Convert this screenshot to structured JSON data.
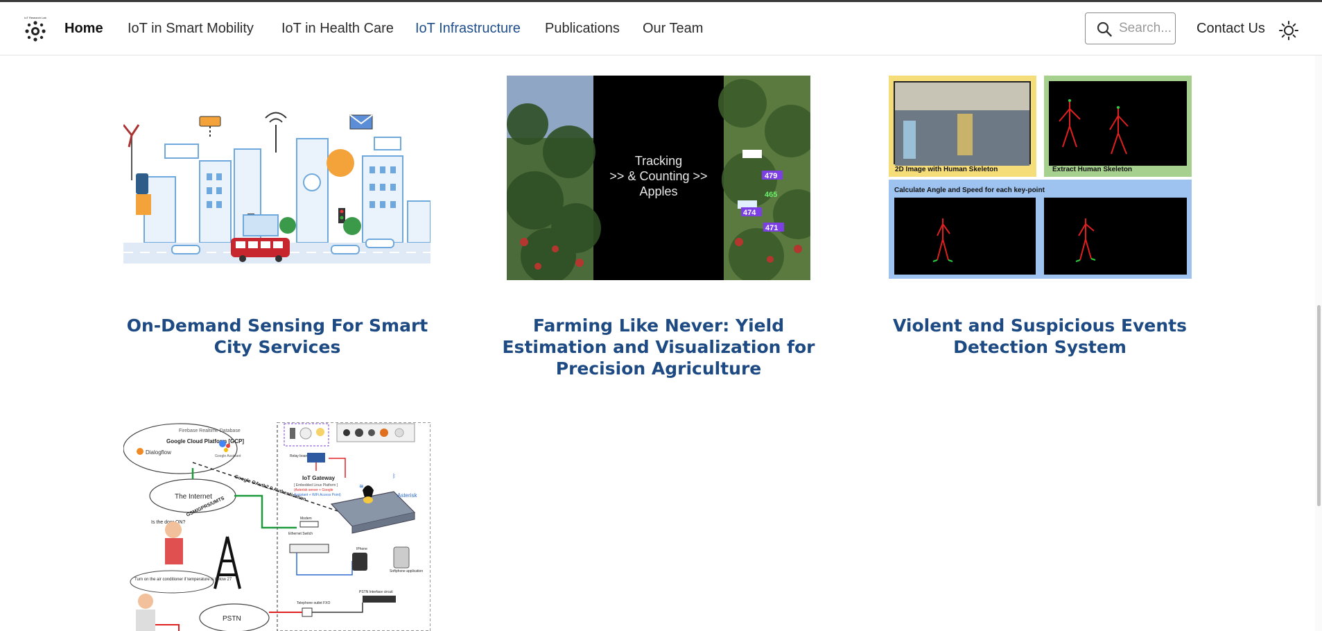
{
  "nav": {
    "logo_text": "IoT Research Lab",
    "home": "Home",
    "items": [
      "IoT in Smart Mobility",
      "IoT in Health Care",
      "IoT Infrastructure",
      "Publications",
      "Our Team"
    ],
    "active_item": "IoT Infrastructure",
    "search_placeholder": "Search...",
    "contact": "Contact Us",
    "theme_icon": "sun-icon",
    "accent_color": "#1f4e8c"
  },
  "cards": [
    {
      "title": "On-Demand Sensing For Smart City Services",
      "image": "smart-city-illustration"
    },
    {
      "title": "Farming Like Never: Yield Estimation and Visualization for Precision Agriculture",
      "image": "apple-tracking-image",
      "image_text": "Tracking >> & Counting >> Apples",
      "image_text_lines": [
        ">>",
        "& Counting",
        "Apples"
      ],
      "image_text_first": "Tracking",
      "labels": [
        "479",
        "474",
        "471",
        "465"
      ]
    },
    {
      "title": "Violent and Suspicious Events Detection System",
      "image": "human-skeleton-pipeline",
      "panel_labels": [
        "2D Image with Human Skeleton",
        "Extract Human Skeleton",
        "Calculate Angle and Speed for each key-point"
      ]
    },
    {
      "title": "",
      "image": "iot-gateway-architecture-diagram",
      "diagram_labels": {
        "firebase": "Firebase Realtime Database",
        "gcp": "Google Cloud Platform [GCP]",
        "dialogflow": "Dialogflow",
        "assistant": "Google Assistant",
        "oauth": "Google OAuth2.0 Authentication",
        "internet": "The Internet",
        "gateway": "IoT Gateway",
        "gateway_sub": "[ Embedded Linux Platform ]",
        "gateway_red": "(Asterisk server + Google",
        "gateway_blue": "Assistant + WiFi Access Point)",
        "relay": "Relay board",
        "network": "GSM/GPRS/UMTS",
        "question": "Is the door ON?",
        "question2": "Turn on the air conditioner if temperature is below 27",
        "switch": "Ethernet Switch",
        "iphone": "IPhone",
        "softphone": "Softphone application",
        "asterisk": "Asterisk",
        "pstn": "PSTN",
        "pstn_interface": "PSTN Interface circuit",
        "telephone": "Telephone outlet FXO",
        "modem": "Modem"
      }
    }
  ],
  "colors": {
    "title_color": "#1d4a82",
    "page_bg": "#ffffff"
  }
}
